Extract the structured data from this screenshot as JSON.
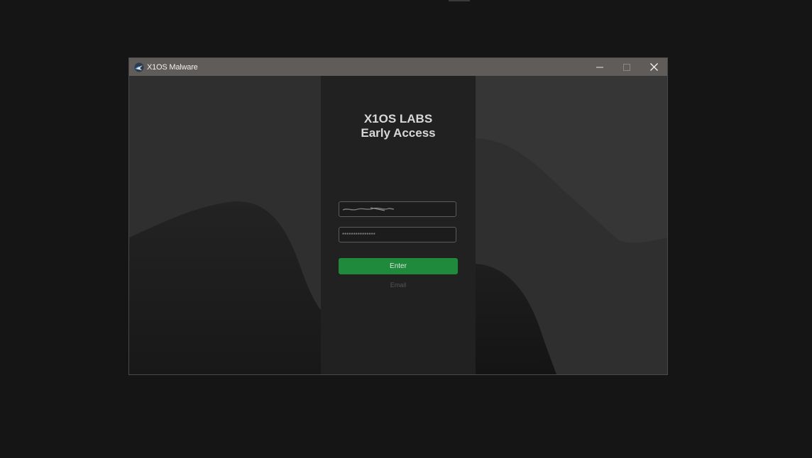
{
  "window": {
    "title": "X1OS Malware",
    "icon": "x1os-app-icon",
    "controls": [
      "minimize-icon",
      "maximize-icon",
      "close-icon"
    ]
  },
  "login": {
    "heading_line1": "X1OS LABS",
    "heading_line2": "Early Access",
    "username_value": "",
    "password_value": "***************",
    "enter_label": "Enter",
    "email_label": "Email"
  },
  "colors": {
    "titlebar": "#5f5c59",
    "panel": "#212121",
    "accent_green": "#1f8a3c",
    "background": "#151515"
  }
}
